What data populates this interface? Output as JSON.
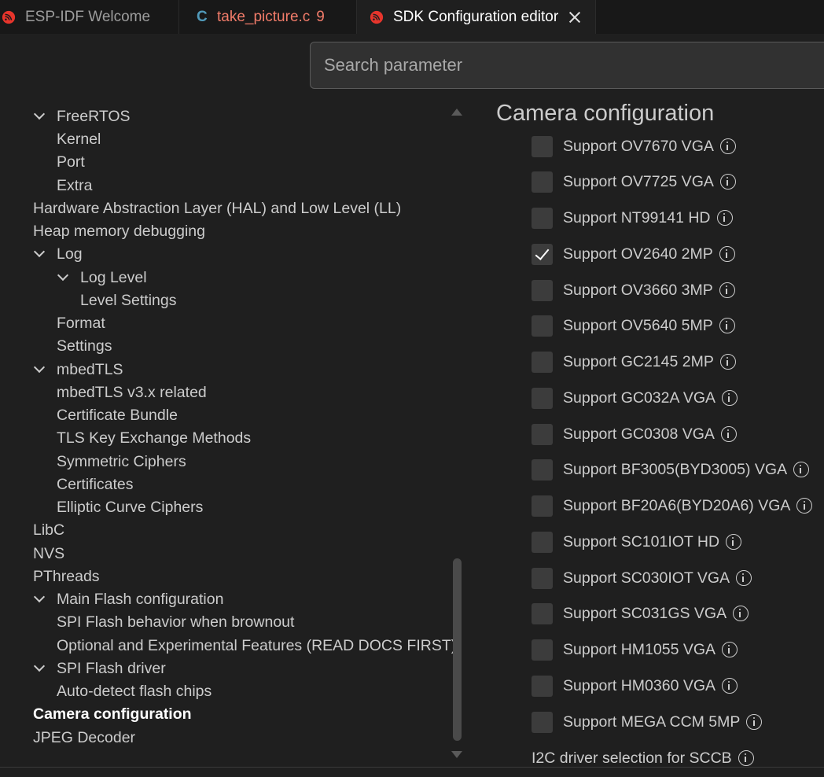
{
  "tabs": [
    {
      "label": "ESP-IDF Welcome",
      "icon": "espressif-icon"
    },
    {
      "label": "take_picture.c",
      "icon": "c-file-icon",
      "icon_glyph": "C",
      "problems": "9"
    },
    {
      "label": "SDK Configuration editor",
      "icon": "espressif-icon",
      "active": true
    }
  ],
  "search": {
    "placeholder": "Search parameter",
    "value": ""
  },
  "tree": [
    {
      "label": "FreeRTOS",
      "expanded": true
    },
    {
      "label": "Kernel"
    },
    {
      "label": "Port"
    },
    {
      "label": "Extra"
    },
    {
      "label": "Hardware Abstraction Layer (HAL) and Low Level (LL)"
    },
    {
      "label": "Heap memory debugging"
    },
    {
      "label": "Log",
      "expanded": true
    },
    {
      "label": "Log Level",
      "expanded": true
    },
    {
      "label": "Level Settings"
    },
    {
      "label": "Format"
    },
    {
      "label": "Settings"
    },
    {
      "label": "mbedTLS",
      "expanded": true
    },
    {
      "label": "mbedTLS v3.x related"
    },
    {
      "label": "Certificate Bundle"
    },
    {
      "label": "TLS Key Exchange Methods"
    },
    {
      "label": "Symmetric Ciphers"
    },
    {
      "label": "Certificates"
    },
    {
      "label": "Elliptic Curve Ciphers"
    },
    {
      "label": "LibC"
    },
    {
      "label": "NVS"
    },
    {
      "label": "PThreads"
    },
    {
      "label": "Main Flash configuration",
      "expanded": true
    },
    {
      "label": "SPI Flash behavior when brownout"
    },
    {
      "label": "Optional and Experimental Features (READ DOCS FIRST)"
    },
    {
      "label": "SPI Flash driver",
      "expanded": true
    },
    {
      "label": "Auto-detect flash chips"
    },
    {
      "label": "Camera configuration",
      "selected": true
    },
    {
      "label": "JPEG Decoder"
    }
  ],
  "section": {
    "title": "Camera configuration"
  },
  "options": [
    {
      "label": "Support OV7670 VGA",
      "checked": false
    },
    {
      "label": "Support OV7725 VGA",
      "checked": false
    },
    {
      "label": "Support NT99141 HD",
      "checked": false
    },
    {
      "label": "Support OV2640 2MP",
      "checked": true
    },
    {
      "label": "Support OV3660 3MP",
      "checked": false
    },
    {
      "label": "Support OV5640 5MP",
      "checked": false
    },
    {
      "label": "Support GC2145 2MP",
      "checked": false
    },
    {
      "label": "Support GC032A VGA",
      "checked": false
    },
    {
      "label": "Support GC0308 VGA",
      "checked": false
    },
    {
      "label": "Support BF3005(BYD3005) VGA",
      "checked": false
    },
    {
      "label": "Support BF20A6(BYD20A6) VGA",
      "checked": false
    },
    {
      "label": "Support SC101IOT HD",
      "checked": false
    },
    {
      "label": "Support SC030IOT VGA",
      "checked": false
    },
    {
      "label": "Support SC031GS VGA",
      "checked": false
    },
    {
      "label": "Support HM1055 VGA",
      "checked": false
    },
    {
      "label": "Support HM0360 VGA",
      "checked": false
    },
    {
      "label": "Support MEGA CCM 5MP",
      "checked": false
    }
  ],
  "i2c": {
    "label": "I2C driver selection for SCCB"
  },
  "colors": {
    "accent_esp": "#e7352c",
    "c_file": "#519aba",
    "modified": "#f27c6a",
    "background": "#1f1f1f"
  }
}
